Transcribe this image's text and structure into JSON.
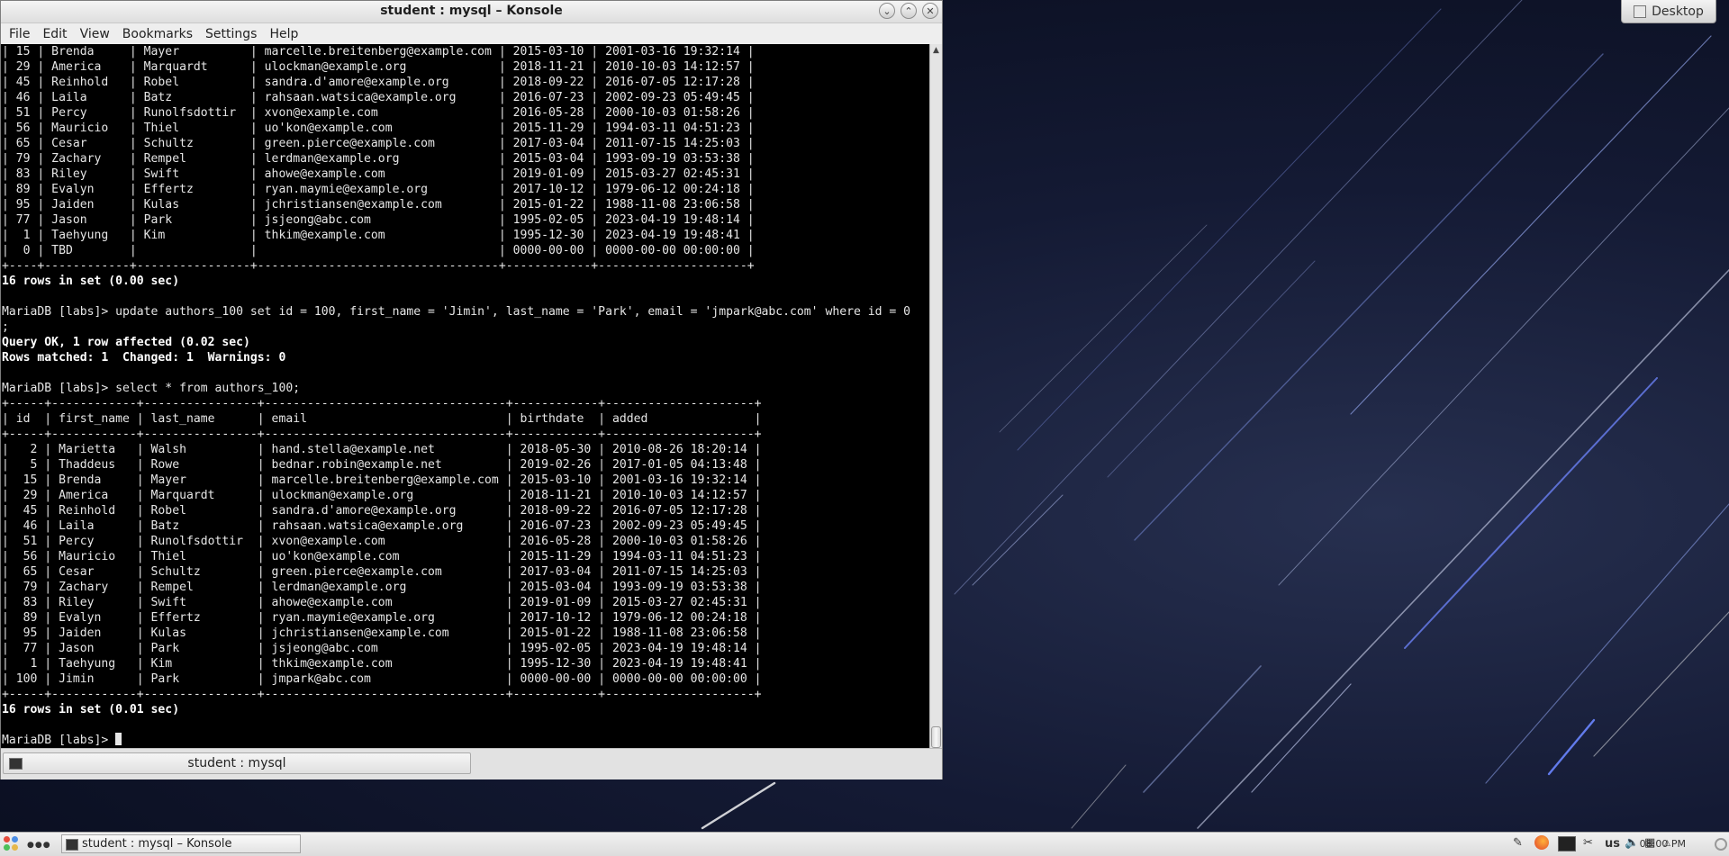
{
  "window": {
    "title": "student : mysql – Konsole",
    "menu": [
      "File",
      "Edit",
      "View",
      "Bookmarks",
      "Settings",
      "Help"
    ]
  },
  "terminal": {
    "lines": [
      {
        "text": "| 15 | Brenda     | Mayer          | marcelle.breitenberg@example.com | 2015-03-10 | 2001-03-16 19:32:14 |",
        "bold": false
      },
      {
        "text": "| 29 | America    | Marquardt      | ulockman@example.org             | 2018-11-21 | 2010-10-03 14:12:57 |",
        "bold": false
      },
      {
        "text": "| 45 | Reinhold   | Robel          | sandra.d'amore@example.org       | 2018-09-22 | 2016-07-05 12:17:28 |",
        "bold": false
      },
      {
        "text": "| 46 | Laila      | Batz           | rahsaan.watsica@example.org      | 2016-07-23 | 2002-09-23 05:49:45 |",
        "bold": false
      },
      {
        "text": "| 51 | Percy      | Runolfsdottir  | xvon@example.com                 | 2016-05-28 | 2000-10-03 01:58:26 |",
        "bold": false
      },
      {
        "text": "| 56 | Mauricio   | Thiel          | uo'kon@example.com               | 2015-11-29 | 1994-03-11 04:51:23 |",
        "bold": false
      },
      {
        "text": "| 65 | Cesar      | Schultz        | green.pierce@example.com         | 2017-03-04 | 2011-07-15 14:25:03 |",
        "bold": false
      },
      {
        "text": "| 79 | Zachary    | Rempel         | lerdman@example.org              | 2015-03-04 | 1993-09-19 03:53:38 |",
        "bold": false
      },
      {
        "text": "| 83 | Riley      | Swift          | ahowe@example.com                | 2019-01-09 | 2015-03-27 02:45:31 |",
        "bold": false
      },
      {
        "text": "| 89 | Evalyn     | Effertz        | ryan.maymie@example.org          | 2017-10-12 | 1979-06-12 00:24:18 |",
        "bold": false
      },
      {
        "text": "| 95 | Jaiden     | Kulas          | jchristiansen@example.com        | 2015-01-22 | 1988-11-08 23:06:58 |",
        "bold": false
      },
      {
        "text": "| 77 | Jason      | Park           | jsjeong@abc.com                  | 1995-02-05 | 2023-04-19 19:48:14 |",
        "bold": false
      },
      {
        "text": "|  1 | Taehyung   | Kim            | thkim@example.com                | 1995-12-30 | 2023-04-19 19:48:41 |",
        "bold": false
      },
      {
        "text": "|  0 | TBD        |                |                                  | 0000-00-00 | 0000-00-00 00:00:00 |",
        "bold": false
      },
      {
        "text": "+----+------------+----------------+----------------------------------+------------+---------------------+",
        "bold": false
      },
      {
        "text": "16 rows in set (0.00 sec)",
        "bold": true
      },
      {
        "text": "",
        "bold": false
      },
      {
        "text": "MariaDB [labs]> update authors_100 set id = 100, first_name = 'Jimin', last_name = 'Park', email = 'jmpark@abc.com' where id = 0",
        "bold": false
      },
      {
        "text": ";",
        "bold": false
      },
      {
        "text": "Query OK, 1 row affected (0.02 sec)",
        "bold": true
      },
      {
        "text": "Rows matched: 1  Changed: 1  Warnings: 0",
        "bold": true
      },
      {
        "text": "",
        "bold": false
      },
      {
        "text": "MariaDB [labs]> select * from authors_100;",
        "bold": false
      },
      {
        "text": "+-----+------------+----------------+----------------------------------+------------+---------------------+",
        "bold": false
      },
      {
        "text": "| id  | first_name | last_name      | email                            | birthdate  | added               |",
        "bold": false
      },
      {
        "text": "+-----+------------+----------------+----------------------------------+------------+---------------------+",
        "bold": false
      },
      {
        "text": "|   2 | Marietta   | Walsh          | hand.stella@example.net          | 2018-05-30 | 2010-08-26 18:20:14 |",
        "bold": false
      },
      {
        "text": "|   5 | Thaddeus   | Rowe           | bednar.robin@example.net         | 2019-02-26 | 2017-01-05 04:13:48 |",
        "bold": false
      },
      {
        "text": "|  15 | Brenda     | Mayer          | marcelle.breitenberg@example.com | 2015-03-10 | 2001-03-16 19:32:14 |",
        "bold": false
      },
      {
        "text": "|  29 | America    | Marquardt      | ulockman@example.org             | 2018-11-21 | 2010-10-03 14:12:57 |",
        "bold": false
      },
      {
        "text": "|  45 | Reinhold   | Robel          | sandra.d'amore@example.org       | 2018-09-22 | 2016-07-05 12:17:28 |",
        "bold": false
      },
      {
        "text": "|  46 | Laila      | Batz           | rahsaan.watsica@example.org      | 2016-07-23 | 2002-09-23 05:49:45 |",
        "bold": false
      },
      {
        "text": "|  51 | Percy      | Runolfsdottir  | xvon@example.com                 | 2016-05-28 | 2000-10-03 01:58:26 |",
        "bold": false
      },
      {
        "text": "|  56 | Mauricio   | Thiel          | uo'kon@example.com               | 2015-11-29 | 1994-03-11 04:51:23 |",
        "bold": false
      },
      {
        "text": "|  65 | Cesar      | Schultz        | green.pierce@example.com         | 2017-03-04 | 2011-07-15 14:25:03 |",
        "bold": false
      },
      {
        "text": "|  79 | Zachary    | Rempel         | lerdman@example.org              | 2015-03-04 | 1993-09-19 03:53:38 |",
        "bold": false
      },
      {
        "text": "|  83 | Riley      | Swift          | ahowe@example.com                | 2019-01-09 | 2015-03-27 02:45:31 |",
        "bold": false
      },
      {
        "text": "|  89 | Evalyn     | Effertz        | ryan.maymie@example.org          | 2017-10-12 | 1979-06-12 00:24:18 |",
        "bold": false
      },
      {
        "text": "|  95 | Jaiden     | Kulas          | jchristiansen@example.com        | 2015-01-22 | 1988-11-08 23:06:58 |",
        "bold": false
      },
      {
        "text": "|  77 | Jason      | Park           | jsjeong@abc.com                  | 1995-02-05 | 2023-04-19 19:48:14 |",
        "bold": false
      },
      {
        "text": "|   1 | Taehyung   | Kim            | thkim@example.com                | 1995-12-30 | 2023-04-19 19:48:41 |",
        "bold": false
      },
      {
        "text": "| 100 | Jimin      | Park           | jmpark@abc.com                   | 0000-00-00 | 0000-00-00 00:00:00 |",
        "bold": false
      },
      {
        "text": "+-----+------------+----------------+----------------------------------+------------+---------------------+",
        "bold": false
      },
      {
        "text": "16 rows in set (0.01 sec)",
        "bold": true
      },
      {
        "text": "",
        "bold": false
      }
    ],
    "prompt": "MariaDB [labs]> "
  },
  "tab": {
    "label": "student : mysql"
  },
  "desktop_button": {
    "label": "Desktop"
  },
  "taskbar": {
    "task_label": "student : mysql – Konsole",
    "keyboard_layout": "us",
    "clock": "08:00 PM"
  },
  "colors": {
    "terminal_bg": "#000000",
    "terminal_fg": "#e6e6e6",
    "desktop_bg": "#0e1430"
  }
}
